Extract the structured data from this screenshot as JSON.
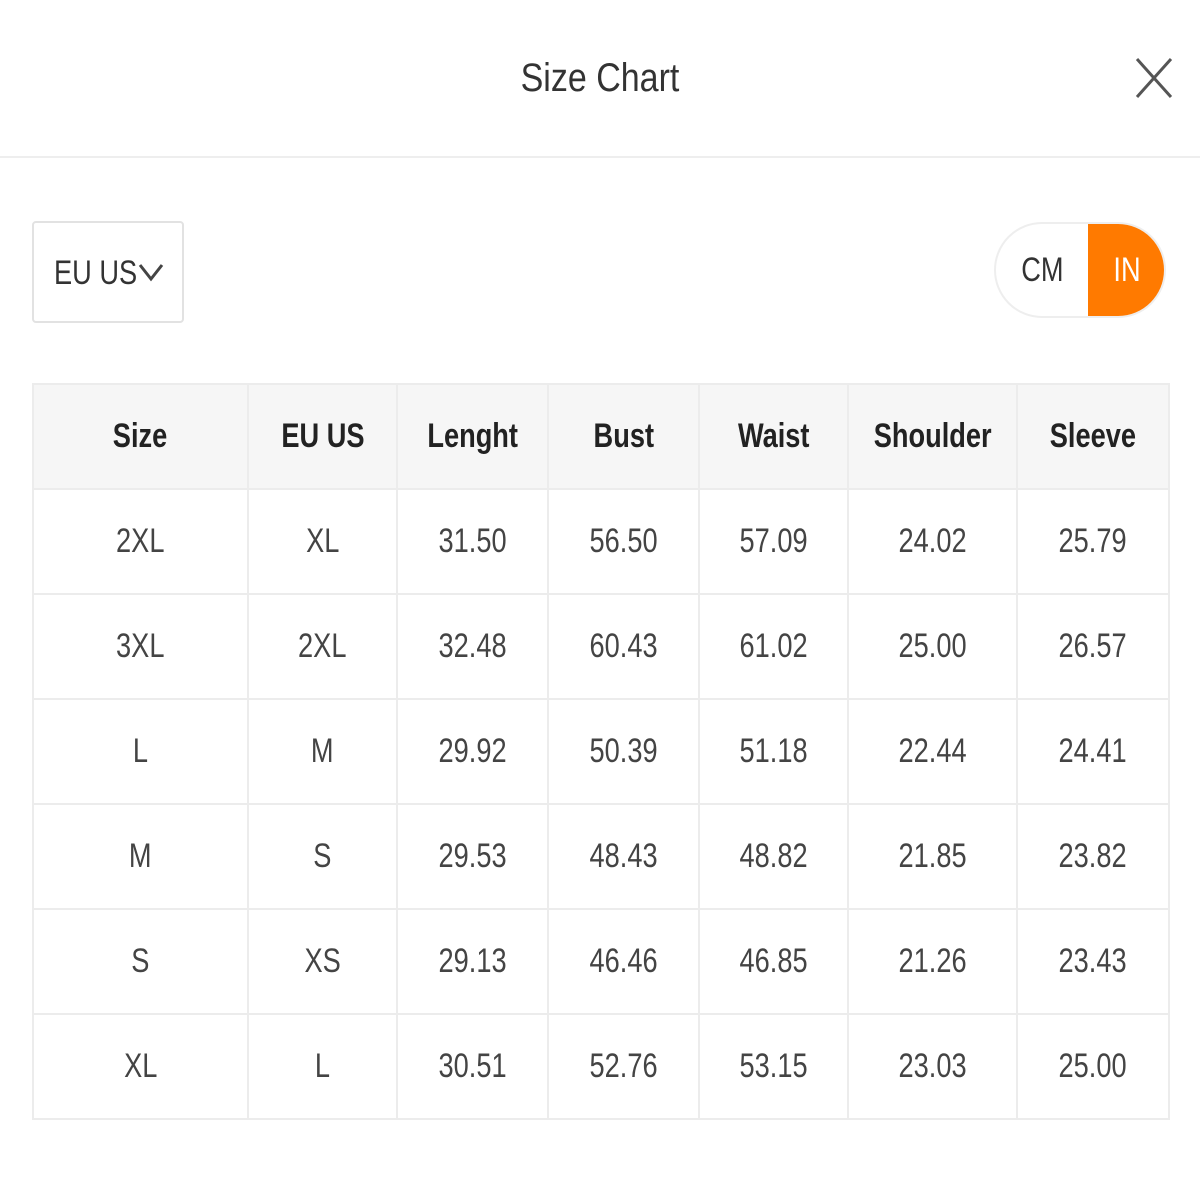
{
  "dialog": {
    "title": "Size Chart"
  },
  "controls": {
    "size_system": "EU US",
    "units": [
      "CM",
      "IN"
    ],
    "selected_unit": "IN",
    "accent_color": "#ff7a00"
  },
  "table": {
    "headers": [
      "Size",
      "EU US",
      "Lenght",
      "Bust",
      "Waist",
      "Shoulder",
      "Sleeve"
    ],
    "rows": [
      [
        "2XL",
        "XL",
        "31.50",
        "56.50",
        "57.09",
        "24.02",
        "25.79"
      ],
      [
        "3XL",
        "2XL",
        "32.48",
        "60.43",
        "61.02",
        "25.00",
        "26.57"
      ],
      [
        "L",
        "M",
        "29.92",
        "50.39",
        "51.18",
        "22.44",
        "24.41"
      ],
      [
        "M",
        "S",
        "29.53",
        "48.43",
        "48.82",
        "21.85",
        "23.82"
      ],
      [
        "S",
        "XS",
        "29.13",
        "46.46",
        "46.85",
        "21.26",
        "23.43"
      ],
      [
        "XL",
        "L",
        "30.51",
        "52.76",
        "53.15",
        "23.03",
        "25.00"
      ]
    ]
  }
}
